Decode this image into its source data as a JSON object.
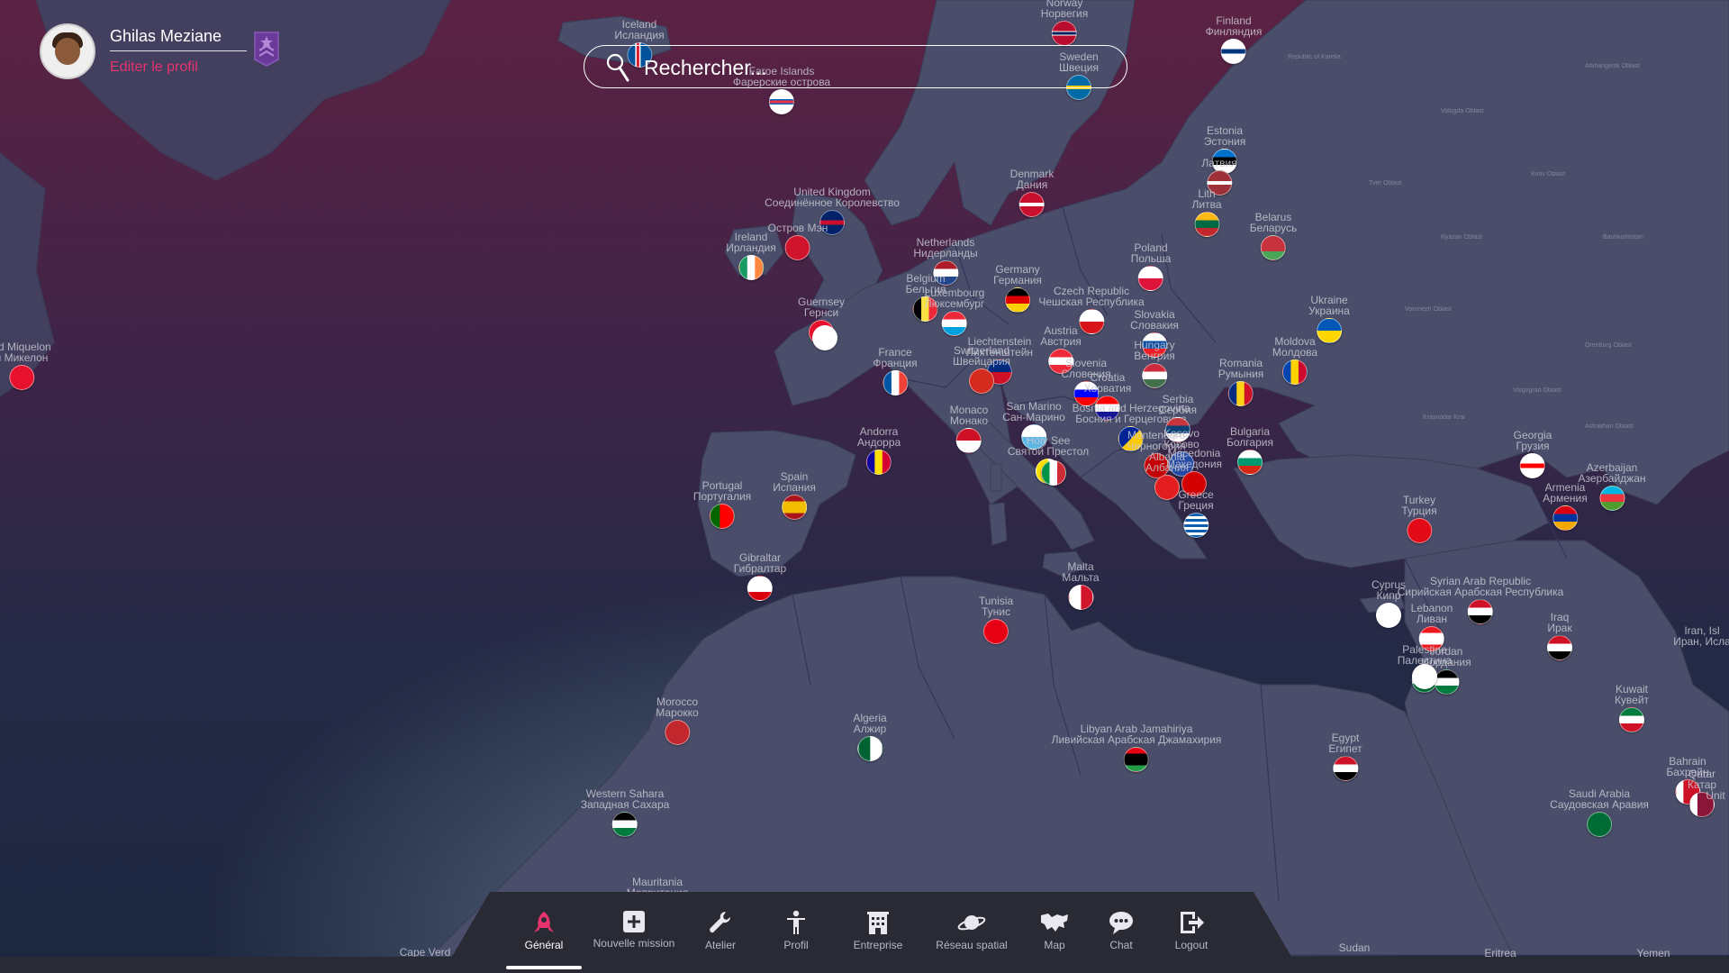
{
  "user": {
    "name": "Ghilas Meziane",
    "edit_profile_label": "Editer le profil"
  },
  "search": {
    "placeholder": "Rechercher..."
  },
  "nav": {
    "items": [
      {
        "label": "Général",
        "icon": "rocket-icon",
        "active": true
      },
      {
        "label": "Nouvelle mission",
        "icon": "plus-square-icon"
      },
      {
        "label": "Atelier",
        "icon": "wrench-icon"
      },
      {
        "label": "Profil",
        "icon": "person-icon"
      },
      {
        "label": "Entreprise",
        "icon": "building-icon"
      },
      {
        "label": "Réseau spatial",
        "icon": "planet-icon"
      },
      {
        "label": "Map",
        "icon": "map-icon"
      },
      {
        "label": "Chat",
        "icon": "chat-icon"
      },
      {
        "label": "Logout",
        "icon": "logout-icon"
      }
    ]
  },
  "countries": [
    {
      "key": "iceland",
      "name": "Iceland",
      "name_ru": "Исландия"
    },
    {
      "key": "norway",
      "name": "Norway",
      "name_ru": "Норвегия"
    },
    {
      "key": "finland",
      "name": "Finland",
      "name_ru": "Финляндия"
    },
    {
      "key": "faroe",
      "name": "Faroe Islands",
      "name_ru": "Фарерские острова"
    },
    {
      "key": "sweden",
      "name": "Sweden",
      "name_ru": "Швеция"
    },
    {
      "key": "estonia",
      "name": "Estonia",
      "name_ru": "Эстония"
    },
    {
      "key": "latvia",
      "name": "",
      "name_ru": "Латвия"
    },
    {
      "key": "lithuania",
      "name": "Lith",
      "name_ru": "Литва"
    },
    {
      "key": "belarus",
      "name": "Belarus",
      "name_ru": "Беларусь"
    },
    {
      "key": "denmark",
      "name": "Denmark",
      "name_ru": "Дания"
    },
    {
      "key": "uk",
      "name": "United Kingdom",
      "name_ru": "Соединённое Королевство"
    },
    {
      "key": "isleofman",
      "name": "",
      "name_ru": "Остров Мэн"
    },
    {
      "key": "ireland",
      "name": "Ireland",
      "name_ru": "Ирландия"
    },
    {
      "key": "netherlands",
      "name": "Netherlands",
      "name_ru": "Нидерланды"
    },
    {
      "key": "germany",
      "name": "Germany",
      "name_ru": "Германия"
    },
    {
      "key": "poland",
      "name": "Poland",
      "name_ru": "Польша"
    },
    {
      "key": "ukraine",
      "name": "Ukraine",
      "name_ru": "Украина"
    },
    {
      "key": "belgium",
      "name": "Belgium",
      "name_ru": "Бельгия"
    },
    {
      "key": "luxembourg",
      "name": "Luxembourg",
      "name_ru": "Люксембург"
    },
    {
      "key": "czech",
      "name": "Czech Republic",
      "name_ru": "Чешская Республика"
    },
    {
      "key": "slovakia",
      "name": "Slovakia",
      "name_ru": "Словакия"
    },
    {
      "key": "guernsey",
      "name": "Guernsey",
      "name_ru": "Гернси"
    },
    {
      "key": "jersey",
      "name": "",
      "name_ru": ""
    },
    {
      "key": "liechtenstein",
      "name": "Liechtenstein",
      "name_ru": "Лихтенштейн"
    },
    {
      "key": "austria",
      "name": "Austria",
      "name_ru": "Австрия"
    },
    {
      "key": "switzerland",
      "name": "Switzerland",
      "name_ru": "Швейцария"
    },
    {
      "key": "hungary",
      "name": "Hungary",
      "name_ru": "Венгрия"
    },
    {
      "key": "moldova",
      "name": "Moldova",
      "name_ru": "Молдова"
    },
    {
      "key": "romania",
      "name": "Romania",
      "name_ru": "Румыния"
    },
    {
      "key": "france",
      "name": "France",
      "name_ru": "Франция"
    },
    {
      "key": "slovenia",
      "name": "Slovenia",
      "name_ru": "Словения"
    },
    {
      "key": "croatia",
      "name": "Croatia",
      "name_ru": "Хорватия"
    },
    {
      "key": "bosnia",
      "name": "Bosnia and Herzegovina",
      "name_ru": "Босния и Герцеговина"
    },
    {
      "key": "serbia",
      "name": "Serbia",
      "name_ru": "Сербия"
    },
    {
      "key": "monaco",
      "name": "Monaco",
      "name_ru": "Монако"
    },
    {
      "key": "sanmarino",
      "name": "San Marino",
      "name_ru": "Сан-Марино"
    },
    {
      "key": "vatican",
      "name": "Holy See",
      "name_ru": "Святой Престол"
    },
    {
      "key": "italy",
      "name": "",
      "name_ru": ""
    },
    {
      "key": "montenegro",
      "name": "Montenegro",
      "name_ru": "Черногория"
    },
    {
      "key": "kosovo",
      "name": "Kosovo",
      "name_ru": "Косово"
    },
    {
      "key": "albania",
      "name": "Albania",
      "name_ru": "Албания"
    },
    {
      "key": "macedonia",
      "name": "Macedonia",
      "name_ru": "Македония"
    },
    {
      "key": "bulgaria",
      "name": "Bulgaria",
      "name_ru": "Болгария"
    },
    {
      "key": "georgia",
      "name": "Georgia",
      "name_ru": "Грузия"
    },
    {
      "key": "azerbaijan",
      "name": "Azerbaijan",
      "name_ru": "Азербайджан"
    },
    {
      "key": "armenia",
      "name": "Armenia",
      "name_ru": "Армения"
    },
    {
      "key": "andorra",
      "name": "Andorra",
      "name_ru": "Андорра"
    },
    {
      "key": "portugal",
      "name": "Portugal",
      "name_ru": "Португалия"
    },
    {
      "key": "spain",
      "name": "Spain",
      "name_ru": "Испания"
    },
    {
      "key": "greece",
      "name": "Greece",
      "name_ru": "Греция"
    },
    {
      "key": "turkey",
      "name": "Turkey",
      "name_ru": "Турция"
    },
    {
      "key": "gibraltar",
      "name": "Gibraltar",
      "name_ru": "Гибралтар"
    },
    {
      "key": "malta",
      "name": "Malta",
      "name_ru": "Мальта"
    },
    {
      "key": "tunisia",
      "name": "Tunisia",
      "name_ru": "Тунис"
    },
    {
      "key": "cyprus",
      "name": "Cyprus",
      "name_ru": "Кипр"
    },
    {
      "key": "syria",
      "name": "Syrian Arab Republic",
      "name_ru": "Сирийская Арабская Республика"
    },
    {
      "key": "lebanon",
      "name": "Lebanon",
      "name_ru": "Ливан"
    },
    {
      "key": "iraq",
      "name": "Iraq",
      "name_ru": "Ирак"
    },
    {
      "key": "palestine",
      "name": "Palestine",
      "name_ru": "Палестина"
    },
    {
      "key": "jordan",
      "name": "Jordan",
      "name_ru": "Иордания"
    },
    {
      "key": "israel",
      "name": "",
      "name_ru": ""
    },
    {
      "key": "morocco",
      "name": "Morocco",
      "name_ru": "Марокко"
    },
    {
      "key": "algeria",
      "name": "Algeria",
      "name_ru": "Алжир"
    },
    {
      "key": "libya",
      "name": "Libyan Arab Jamahiriya",
      "name_ru": "Ливийская Арабская Джамахирия"
    },
    {
      "key": "egypt",
      "name": "Egypt",
      "name_ru": "Египет"
    },
    {
      "key": "kuwait",
      "name": "Kuwait",
      "name_ru": "Кувейт"
    },
    {
      "key": "bahrain",
      "name": "Bahrain",
      "name_ru": "Бахрейн"
    },
    {
      "key": "qatar",
      "name": "Qatar",
      "name_ru": "Катар"
    },
    {
      "key": "saudi",
      "name": "Saudi Arabia",
      "name_ru": "Саудовская Аравия"
    },
    {
      "key": "westernsahara",
      "name": "Western Sahara",
      "name_ru": "Западная Сахара"
    },
    {
      "key": "spm",
      "name": "nd Miquelon",
      "name_ru": "и Микелон"
    }
  ],
  "edge_labels": {
    "mauritania": "Mauritania",
    "mauritania_ru": "Мавритания",
    "cape_verde": "Cape Verd",
    "sudan": "Sudan",
    "eritrea": "Eritrea",
    "yemen": "Yemen",
    "iran": "Iran, Isl",
    "iran_ru": "Иран, Исла",
    "uae": "Unit"
  }
}
